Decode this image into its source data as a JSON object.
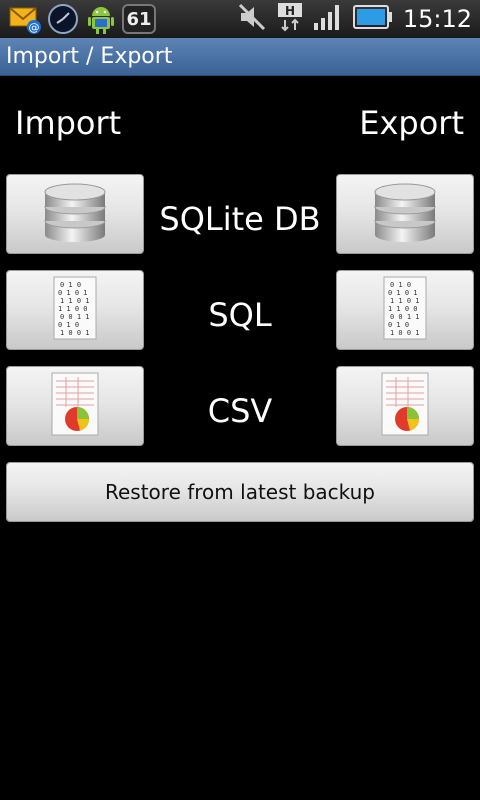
{
  "status_bar": {
    "badge_count": "61",
    "time": "15:12",
    "icons": [
      "mail-icon",
      "clock-widget-icon",
      "android-icon",
      "count-badge",
      "mute-icon",
      "data-transfer-icon",
      "signal-icon",
      "battery-icon"
    ]
  },
  "title_bar": {
    "title": "Import / Export"
  },
  "columns": {
    "import": "Import",
    "export": "Export"
  },
  "rows": [
    {
      "label": "SQLite DB",
      "icon": "database-icon"
    },
    {
      "label": "SQL",
      "icon": "binary-document-icon"
    },
    {
      "label": "CSV",
      "icon": "spreadsheet-chart-icon"
    }
  ],
  "restore_button": {
    "label": "Restore from latest backup"
  },
  "colors": {
    "title_bar": "#4a72a6",
    "background": "#000000",
    "button": "#dcdcdc"
  }
}
